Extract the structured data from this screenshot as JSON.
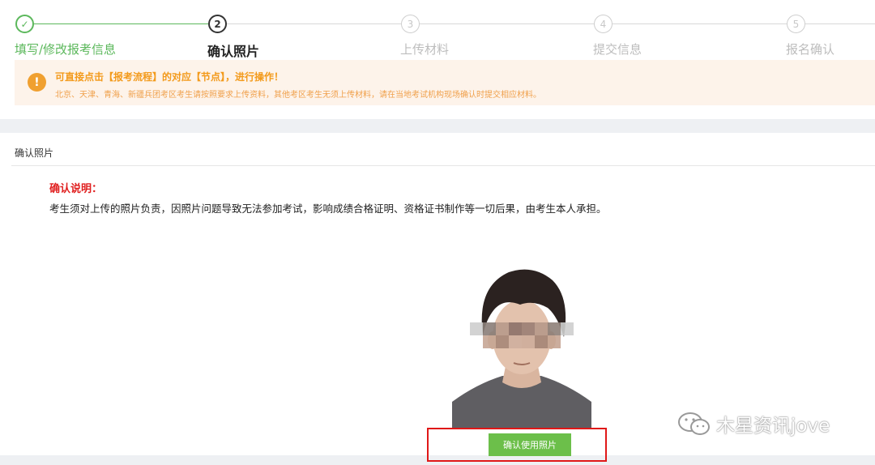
{
  "steps": [
    {
      "num": "✓",
      "label": "填写/修改报考信息",
      "state": "done"
    },
    {
      "num": "2",
      "label": "确认照片",
      "state": "current"
    },
    {
      "num": "3",
      "label": "上传材料",
      "state": "todo"
    },
    {
      "num": "4",
      "label": "提交信息",
      "state": "todo"
    },
    {
      "num": "5",
      "label": "报名确认",
      "state": "todo"
    }
  ],
  "notice": {
    "icon": "!",
    "title": "可直接点击【报考流程】的对应【节点】，进行操作！",
    "text": "北京、天津、青海、新疆兵团考区考生请按照要求上传资料，其他考区考生无须上传材料，请在当地考试机构现场确认时提交相应材料。"
  },
  "section": {
    "title": "确认照片",
    "note_title": "确认说明：",
    "note_text": "考生须对上传的照片负责，因照片问题导致无法参加考试，影响成绩合格证明、资格证书制作等一切后果，由考生本人承担。"
  },
  "confirm_button": "确认使用照片",
  "watermark": "木星资讯jove",
  "colors": {
    "done": "#5cb85c",
    "warning": "#f39a1b",
    "danger": "#e02020",
    "button": "#6cbf4a"
  }
}
